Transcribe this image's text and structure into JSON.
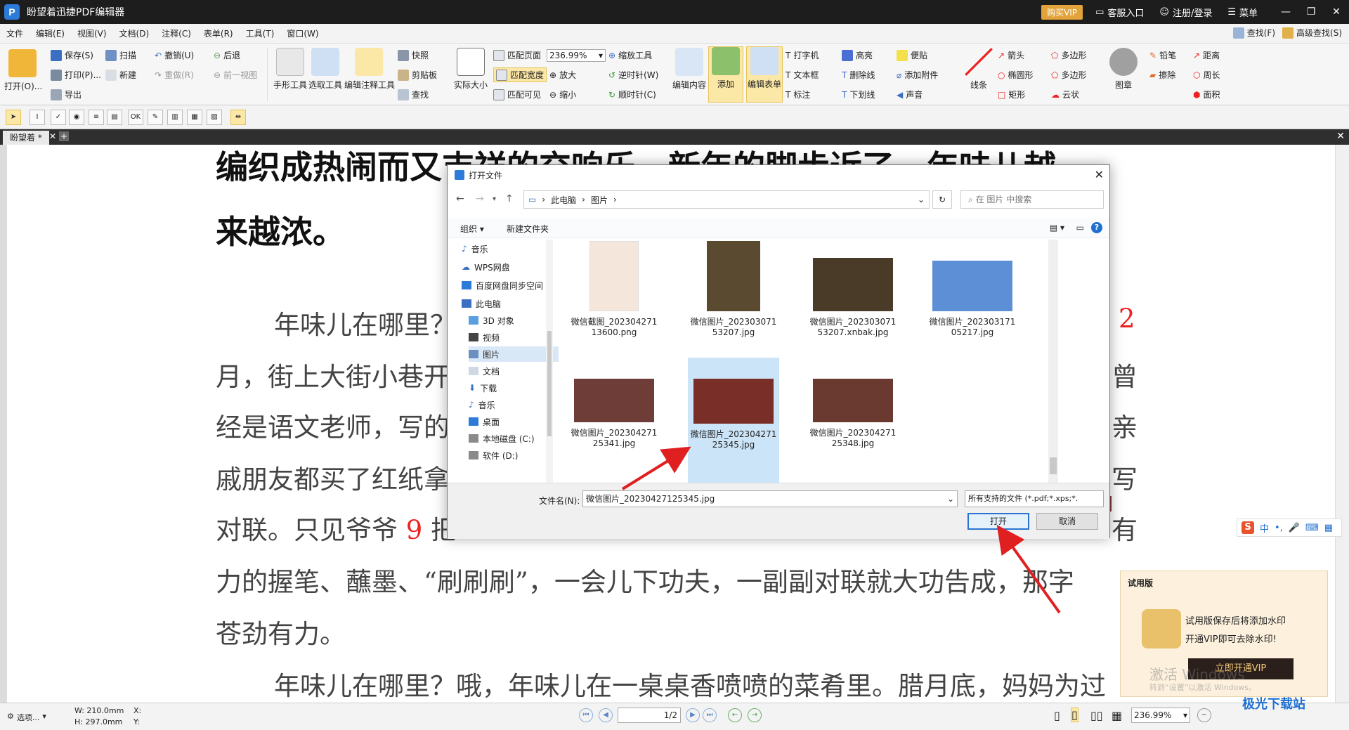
{
  "app": {
    "title": "盼望着迅捷PDF编辑器",
    "vip_label": "购买VIP",
    "support_label": "客服入口",
    "login_label": "注册/登录",
    "menu_label": "菜单"
  },
  "menu": [
    "文件",
    "编辑(E)",
    "视图(V)",
    "文档(D)",
    "注释(C)",
    "表单(R)",
    "工具(T)",
    "窗口(W)"
  ],
  "menu_right": {
    "find": "查找(F)",
    "advanced_find": "高级查找(S)"
  },
  "ribbon": {
    "open": "打开(O)...",
    "save": "保存(S)",
    "print": "打印(P)...",
    "export": "导出",
    "scan": "扫描",
    "new": "新建",
    "undo": "撤销(U)",
    "redo": "重做(R)",
    "back": "后退",
    "prev_view": "前一视图",
    "hand": "手形工具",
    "select": "选取工具",
    "edit_annot": "编辑注释工具",
    "snapshot": "快照",
    "clipboard": "剪贴板",
    "find": "查找",
    "actual_size": "实际大小",
    "fit_page": "匹配页面",
    "fit_width": "匹配宽度",
    "fit_visible": "匹配可见",
    "zoom_value": "236.99%",
    "zoom_tool": "缩放工具",
    "zoom_in": "放大",
    "zoom_out": "缩小",
    "rotate_ccw": "逆时针(W)",
    "rotate_cw": "顺时针(C)",
    "edit_content": "编辑内容",
    "add": "添加",
    "edit_form": "编辑表单",
    "typewriter": "打字机",
    "textbox": "文本框",
    "callout": "标注",
    "highlight": "高亮",
    "strikeout": "删除线",
    "underline": "下划线",
    "note": "便贴",
    "attach": "添加附件",
    "sound": "声音",
    "line": "线条",
    "arrow": "箭头",
    "ellipse": "椭圆形",
    "rectangle": "矩形",
    "polygon": "多边形",
    "polyline": "多边形",
    "cloud": "云状",
    "stamp": "图章",
    "pencil": "铅笔",
    "eraser": "擦除",
    "distance": "距离",
    "perimeter": "周长",
    "area": "面积"
  },
  "tabs": {
    "doc_tab": "盼望着 *"
  },
  "document": {
    "heading1": "编织成热闹而又吉祥的交响乐。新年的脚步近了，年味儿越",
    "heading2": "来越浓。",
    "line1": "年味儿在哪里？",
    "line1_right": "2",
    "line2": "月，街上大街小巷开",
    "line2_right": "曾",
    "line3": "经是语文老师，写的",
    "line3_right": "亲",
    "line4": "戚朋友都买了红纸拿",
    "line4_right": "写",
    "line5a": "对联。只见爷爷",
    "line5_num": "9",
    "line5b": "把",
    "line5_right": "有",
    "line6": "力的握笔、蘸墨、“刷刷刷”，一会儿下功夫，一副副对联就大功告成，那字",
    "line7": "苍劲有力。",
    "line8": "年味儿在哪里？哦，年味儿在一桌桌香喷喷的菜肴里。腊月底，妈妈为过"
  },
  "dialog": {
    "title": "打开文件",
    "breadcrumb": [
      "此电脑",
      "图片"
    ],
    "search_placeholder": "在 图片 中搜索",
    "organize": "组织",
    "new_folder": "新建文件夹",
    "nav_items": [
      "音乐",
      "WPS网盘",
      "百度网盘同步空间",
      "此电脑",
      "3D 对象",
      "视频",
      "图片",
      "文档",
      "下载",
      "音乐",
      "桌面",
      "本地磁盘 (C:)",
      "软件 (D:)"
    ],
    "files": [
      {
        "name": "微信截图_20230427113600.png",
        "color": "#f5e6dc"
      },
      {
        "name": "微信图片_20230307153207.jpg",
        "color": "#5a4a30"
      },
      {
        "name": "微信图片_20230307153207.xnbak.jpg",
        "color": "#4a3a28"
      },
      {
        "name": "微信图片_20230317105217.jpg",
        "color": "#5d8fd6"
      },
      {
        "name": "微信图片_20230427125341.jpg",
        "color": "#6e3d38"
      },
      {
        "name": "微信图片_20230427125345.jpg",
        "color": "#7a2e28"
      },
      {
        "name": "微信图片_20230427125348.jpg",
        "color": "#6a3a30"
      }
    ],
    "filename_label": "文件名(N):",
    "filename_value": "微信图片_20230427125345.jpg",
    "filetype_value": "所有支持的文件 (*.pdf;*.xps;*.",
    "open_label": "打开",
    "cancel_label": "取消"
  },
  "trial": {
    "title": "试用版",
    "line1": "试用版保存后将添加水印",
    "line2": "开通VIP即可去除水印!",
    "button": "立即开通VIP"
  },
  "watermark": {
    "line1": "激活 Windows",
    "line2": "转到“设置”以激活 Windows。"
  },
  "statusbar": {
    "options": "选项...",
    "width": "W: 210.0mm",
    "height": "H: 297.0mm",
    "x_label": "X:",
    "y_label": "Y:",
    "page_value": "1/2",
    "zoom_value": "236.99%"
  },
  "ime": {
    "lang": "中"
  },
  "site_logo": "极光下载站",
  "colors": {
    "accent": "#2d7bd8",
    "arrow": "#e02020",
    "vip": "#e2a33a"
  }
}
